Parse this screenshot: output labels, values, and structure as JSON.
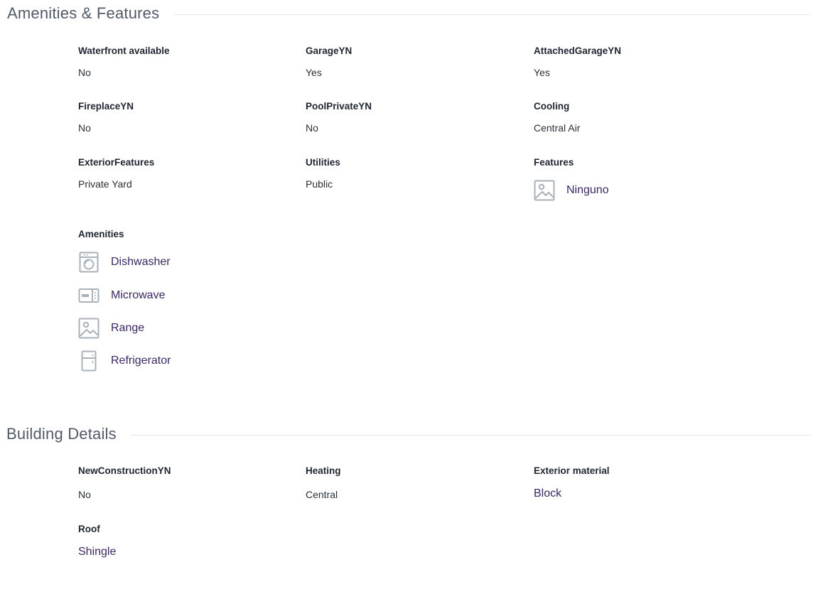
{
  "amenities_section": {
    "title": "Amenities & Features",
    "fields": [
      {
        "label": "Waterfront available",
        "value": "No"
      },
      {
        "label": "GarageYN",
        "value": "Yes"
      },
      {
        "label": "AttachedGarageYN",
        "value": "Yes"
      },
      {
        "label": "FireplaceYN",
        "value": "No"
      },
      {
        "label": "PoolPrivateYN",
        "value": "No"
      },
      {
        "label": "Cooling",
        "value": "Central Air"
      },
      {
        "label": "ExteriorFeatures",
        "value": "Private Yard"
      },
      {
        "label": "Utilities",
        "value": "Public"
      }
    ],
    "features": {
      "label": "Features",
      "items": [
        {
          "text": "Ninguno",
          "icon": "image-placeholder-icon"
        }
      ]
    },
    "amenities": {
      "label": "Amenities",
      "items": [
        {
          "text": "Dishwasher",
          "icon": "dishwasher-icon"
        },
        {
          "text": "Microwave",
          "icon": "microwave-icon"
        },
        {
          "text": "Range",
          "icon": "image-placeholder-icon"
        },
        {
          "text": "Refrigerator",
          "icon": "refrigerator-icon"
        }
      ]
    }
  },
  "building_section": {
    "title": "Building Details",
    "fields": [
      {
        "label": "NewConstructionYN",
        "value": "No"
      },
      {
        "label": "Heating",
        "value": "Central"
      },
      {
        "label": "Exterior material",
        "value": "Block"
      },
      {
        "label": "Roof",
        "value": "Shingle"
      }
    ]
  },
  "colors": {
    "link": "#3b2763",
    "icon": "#a9b1ba",
    "title": "#515a66",
    "divider": "#e4e6ea"
  }
}
